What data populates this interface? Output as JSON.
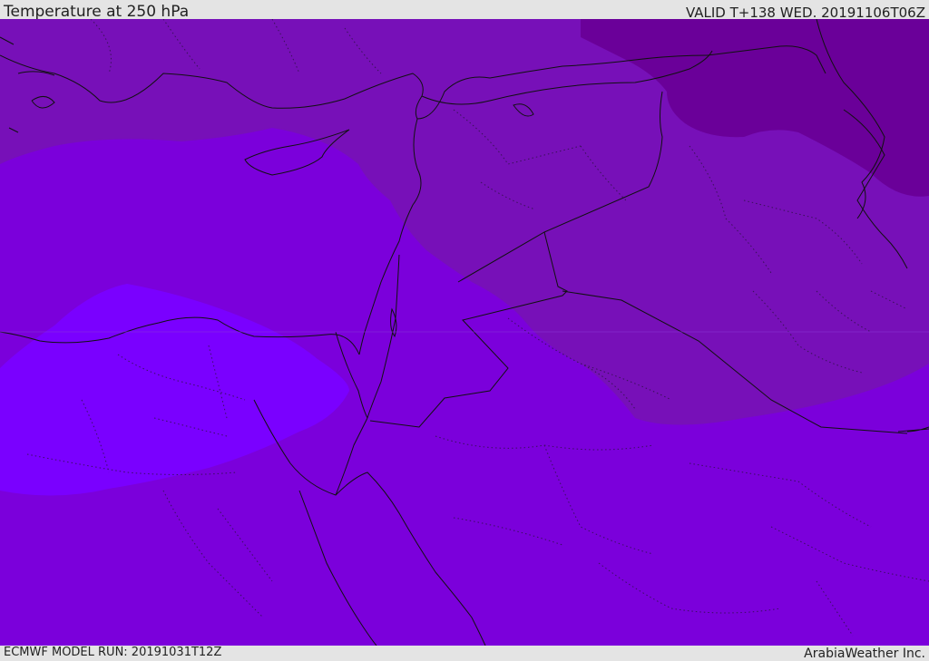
{
  "header": {
    "title": "Temperature at 250 hPa",
    "valid": "VALID T+138 WED. 20191106T06Z"
  },
  "footer": {
    "model_run": "ECMWF MODEL RUN: 20191031T12Z",
    "credit": "ArabiaWeather Inc."
  },
  "colors": {
    "band_base": "#7b00db",
    "band_warmer": "#7100e2",
    "band_warmest": "#7a00ff",
    "band_cool": "#7710b8",
    "band_coldest": "#6a0099",
    "lines": "#111111"
  }
}
